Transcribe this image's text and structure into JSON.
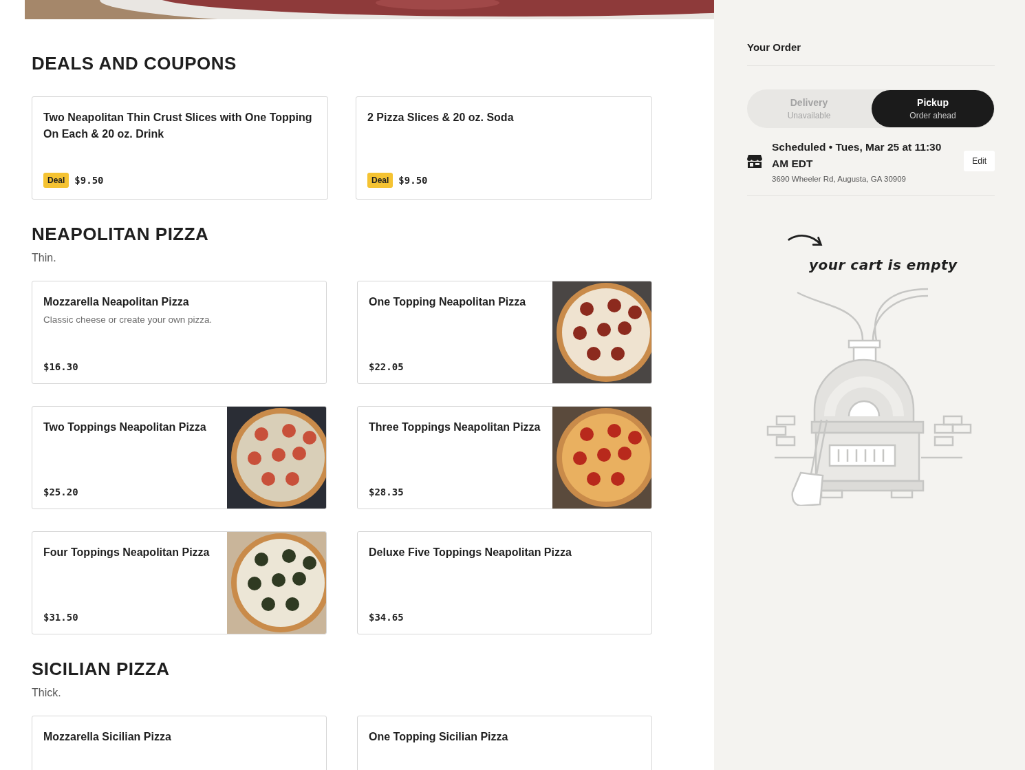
{
  "sections": [
    {
      "title": "DEALS AND COUPONS",
      "kind": "deals",
      "items": [
        {
          "name": "Two Neapolitan Thin Crust Slices with One Topping On Each & 20 oz. Drink",
          "badge": "Deal",
          "price": "$9.50"
        },
        {
          "name": "2 Pizza Slices & 20 oz. Soda",
          "badge": "Deal",
          "price": "$9.50"
        }
      ]
    },
    {
      "title": "NEAPOLITAN PIZZA",
      "description": "Thin.",
      "kind": "menu",
      "items": [
        {
          "name": "Mozzarella Neapolitan Pizza",
          "description": "Classic cheese or create your own pizza.",
          "price": "$16.30"
        },
        {
          "name": "One Topping Neapolitan Pizza",
          "price": "$22.05"
        },
        {
          "name": "Two Toppings Neapolitan Pizza",
          "price": "$25.20"
        },
        {
          "name": "Three Toppings Neapolitan Pizza",
          "price": "$28.35"
        },
        {
          "name": "Four Toppings Neapolitan Pizza",
          "price": "$31.50"
        },
        {
          "name": "Deluxe Five Toppings Neapolitan Pizza",
          "price": "$34.65"
        }
      ]
    },
    {
      "title": "SICILIAN PIZZA",
      "description": "Thick.",
      "kind": "menu",
      "items": [
        {
          "name": "Mozzarella Sicilian Pizza"
        },
        {
          "name": "One Topping Sicilian Pizza"
        }
      ]
    }
  ],
  "order": {
    "title": "Your Order",
    "modes": [
      {
        "label": "Delivery",
        "sublabel": "Unavailable",
        "selected": false
      },
      {
        "label": "Pickup",
        "sublabel": "Order ahead",
        "selected": true
      }
    ],
    "schedule": "Scheduled • Tues, Mar 25 at 11:30 AM EDT",
    "address": "3690 Wheeler Rd, Augusta, GA 30909",
    "edit": "Edit",
    "empty_message": "your cart is empty"
  }
}
